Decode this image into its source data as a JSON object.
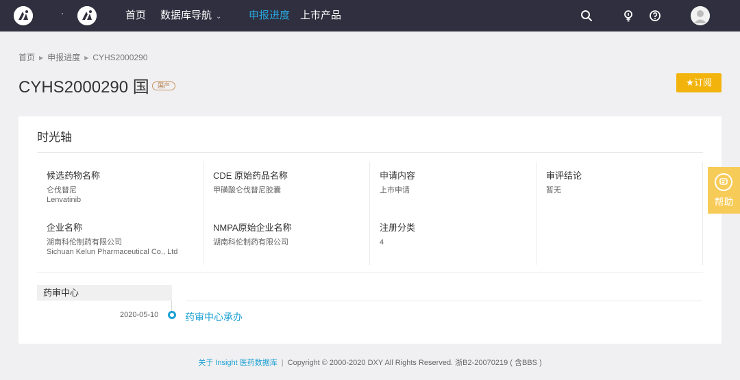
{
  "nav": {
    "items": [
      "首页",
      "数据库导航",
      "申报进度",
      "上市产品"
    ],
    "active_index": 2,
    "accent_color": "#29a8e0",
    "icons": [
      "search-icon",
      "bulb-icon",
      "help-icon",
      "avatar"
    ]
  },
  "breadcrumb": [
    "首页",
    "申报进度",
    "CYHS2000290"
  ],
  "title": "CYHS2000290 国",
  "badge": "国产",
  "subscribe_label": "★订阅",
  "card": {
    "title": "时光轴",
    "fields": {
      "candidate_name": {
        "label": "候选药物名称",
        "value_cn": "仑伐替尼",
        "value_en": "Lenvatinib"
      },
      "cde_name": {
        "label": "CDE 原始药品名称",
        "value": "甲磺酸仑伐替尼胶囊"
      },
      "apply_content": {
        "label": "申请内容",
        "value": "上市申请"
      },
      "review_result": {
        "label": "审评结论",
        "value": "暂无"
      },
      "company": {
        "label": "企业名称",
        "value_cn": "湖南科伦制药有限公司",
        "value_en": "Sichuan Kelun Pharmaceutical Co., Ltd"
      },
      "nmpa_company": {
        "label": "NMPA原始企业名称",
        "value": "湖南科伦制药有限公司"
      },
      "reg_category": {
        "label": "注册分类",
        "value": "4"
      }
    },
    "timeline": {
      "tab": "药审中心",
      "events": [
        {
          "date": "2020-05-10",
          "label": "药审中心承办"
        }
      ]
    }
  },
  "help_label": "帮助",
  "footer": {
    "link": "关于 Insight 医药数据库",
    "sep": "|",
    "copyright": "Copyright © 2000-2020 DXY All Rights Reserved. 浙B2-20070219 ( 含BBS )"
  }
}
